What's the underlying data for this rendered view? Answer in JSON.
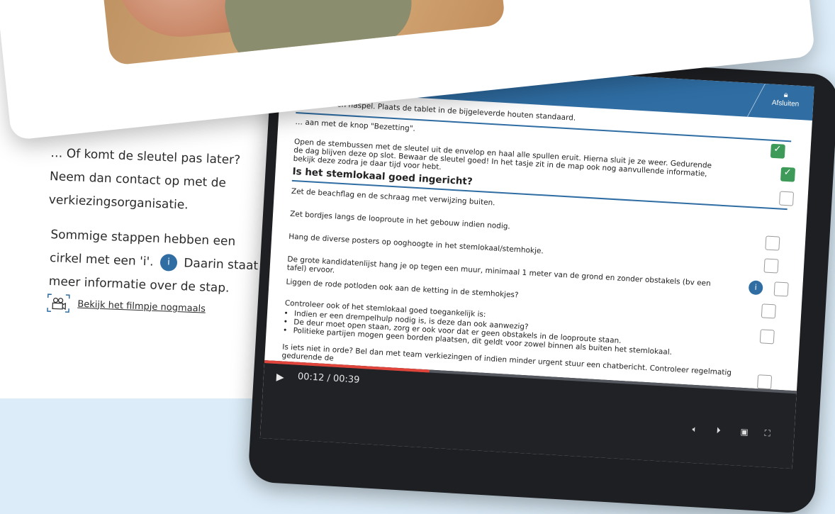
{
  "left_panel": {
    "paragraph1": "… Of komt de sleutel pas later? Neem dan contact op met de verkiezingsorganisatie.",
    "paragraph2_before": "Sommige stappen hebben een cirkel met een 'i'.",
    "info_symbol": "i",
    "paragraph2_after": "Daarin staat meer informatie over de stap.",
    "video_link": "Bekijk het filmpje nogmaals"
  },
  "steps": {
    "current": "Afsluiten",
    "lock_icon": "lock-icon"
  },
  "checklist": {
    "row1": "… oplader en haspel. Plaats de tablet in de bijgeleverde houten standaard.",
    "row2": "… aan met de knop \"Bezetting\".",
    "row3": "Open de stembussen met de sleutel uit de envelop en haal alle spullen eruit. Hierna sluit je ze weer. Gedurende de dag blijven deze op slot. Bewaar de sleutel goed! In het tasje zit in de map ook nog aanvullende informatie, bekijk deze zodra je daar tijd voor hebt.",
    "section_title": "Is het stemlokaal goed ingericht?",
    "items": [
      "Zet de beachflag en de schraag met verwijzing buiten.",
      "Zet bordjes langs de looproute in het gebouw indien nodig.",
      "Hang de diverse posters op ooghoogte in het stemlokaal/stemhokje.",
      "De grote kandidatenlijst hang je op tegen een muur, minimaal 1 meter van de grond en zonder obstakels (bv een tafel) ervoor.",
      "Liggen de rode potloden ook aan de ketting in de stemhokjes?"
    ],
    "accessibility_intro": "Controleer ook of het stemlokaal goed toegankelijk is:",
    "bullets": [
      "Indien er een drempelhulp nodig is, is deze dan ook aanwezig?",
      "De deur moet open staan, zorg er ook voor dat er geen obstakels in de looproute staan.",
      "Politieke partijen mogen geen borden plaatsen, dit geldt voor zowel binnen als buiten het stemlokaal."
    ],
    "footer_text": "Is iets niet in orde? Bel dan met team verkiezingen of indien minder urgent stuur een chatbericht. Controleer regelmatig gedurende de"
  },
  "video": {
    "time": "00:12 / 00:39",
    "progress": 0.31
  },
  "colors": {
    "accent": "#2f6da3",
    "check_done": "#3e9a58",
    "progress": "#e0443a"
  }
}
